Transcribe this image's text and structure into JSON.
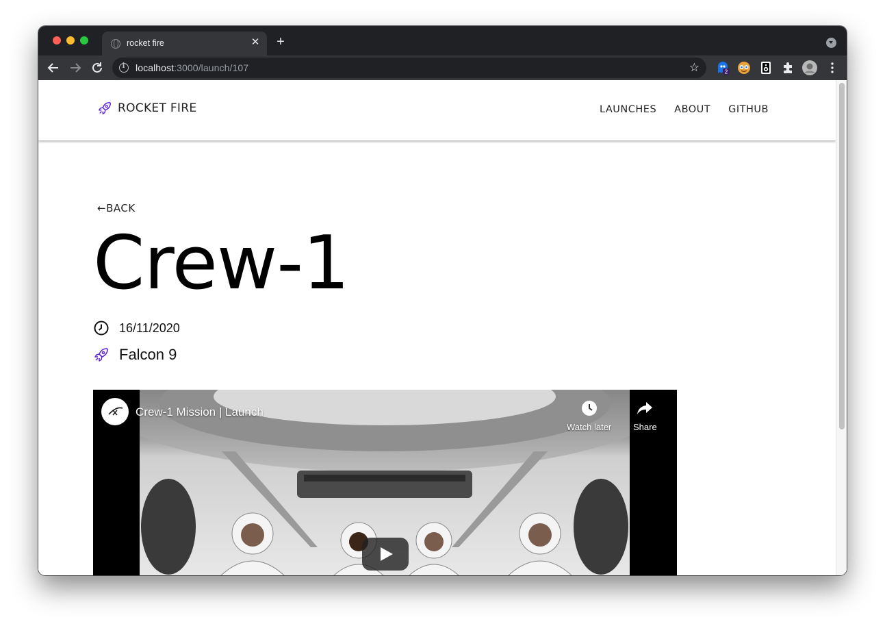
{
  "browser": {
    "tab_title": "rocket fire",
    "url_host": "localhost",
    "url_path": ":3000/launch/107",
    "extension_badge": "2"
  },
  "site": {
    "brand": "ROCKET FIRE",
    "nav": [
      "LAUNCHES",
      "ABOUT",
      "GITHUB"
    ]
  },
  "launch": {
    "back_label": "←BACK",
    "name": "Crew-1",
    "date": "16/11/2020",
    "rocket": "Falcon 9"
  },
  "video": {
    "title": "Crew-1 Mission | Launch",
    "watch_later": "Watch later",
    "share": "Share"
  },
  "colors": {
    "accent": "#5b21d6",
    "browser_frame": "#202124",
    "toolbar": "#35363a"
  }
}
